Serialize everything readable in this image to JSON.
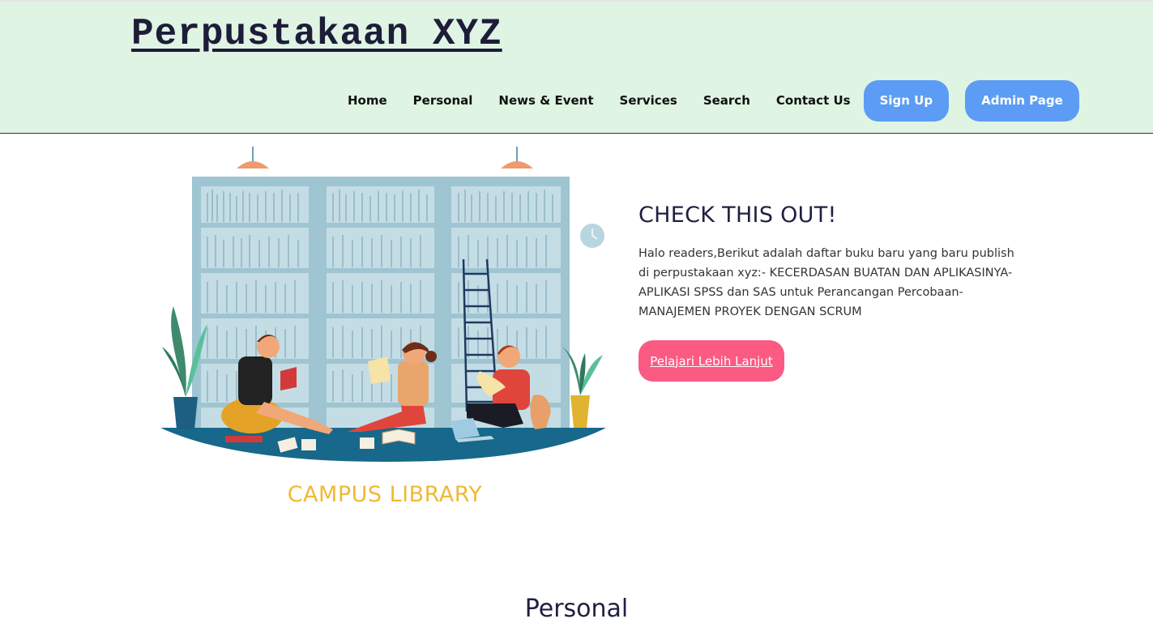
{
  "header": {
    "brand": "Perpustakaan XYZ",
    "nav": [
      {
        "label": "Home"
      },
      {
        "label": "Personal"
      },
      {
        "label": "News & Event"
      },
      {
        "label": "Services"
      },
      {
        "label": "Search"
      },
      {
        "label": "Contact Us"
      }
    ],
    "signup_label": "Sign Up",
    "admin_label": "Admin Page"
  },
  "hero": {
    "illustration_caption": "CAMPUS LIBRARY",
    "title": "CHECK THIS OUT!",
    "body": "Halo readers,Berikut adalah daftar buku baru yang baru publish di perpustakaan xyz:- KECERDASAN BUATAN DAN APLIKASINYA- APLIKASI SPSS dan SAS untuk Perancangan Percobaan- MANAJEMEN PROYEK DENGAN SCRUM",
    "cta_label": "Pelajari Lebih Lanjut"
  },
  "next_section": {
    "title": "Personal"
  },
  "colors": {
    "header_bg": "#dff4e3",
    "nav_button": "#5c9cf4",
    "cta_button": "#fb5a82",
    "caption": "#f0b935"
  }
}
